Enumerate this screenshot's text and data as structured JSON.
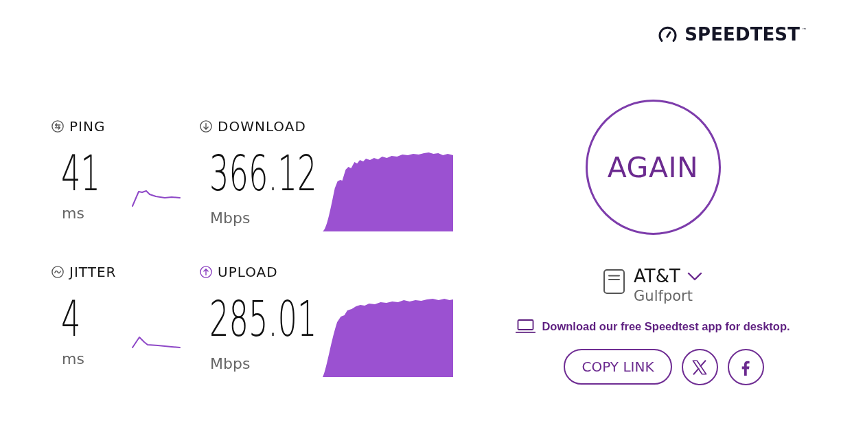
{
  "logo": {
    "wordmark": "SPEEDTEST",
    "trademark": "™"
  },
  "metrics": [
    {
      "kind": "ping",
      "label": "PING",
      "value": "41",
      "unit": "ms"
    },
    {
      "kind": "download",
      "label": "DOWNLOAD",
      "value": "366.12",
      "unit": "Mbps"
    },
    {
      "kind": "jitter",
      "label": "JITTER",
      "value": "4",
      "unit": "ms"
    },
    {
      "kind": "upload",
      "label": "UPLOAD",
      "value": "285.01",
      "unit": "Mbps"
    }
  ],
  "again_button": {
    "label": "AGAIN"
  },
  "server": {
    "provider": "AT&T",
    "location": "Gulfport"
  },
  "app_promo": {
    "text": "Download our free Speedtest app for desktop."
  },
  "share": {
    "copy_link": "COPY LINK"
  }
}
